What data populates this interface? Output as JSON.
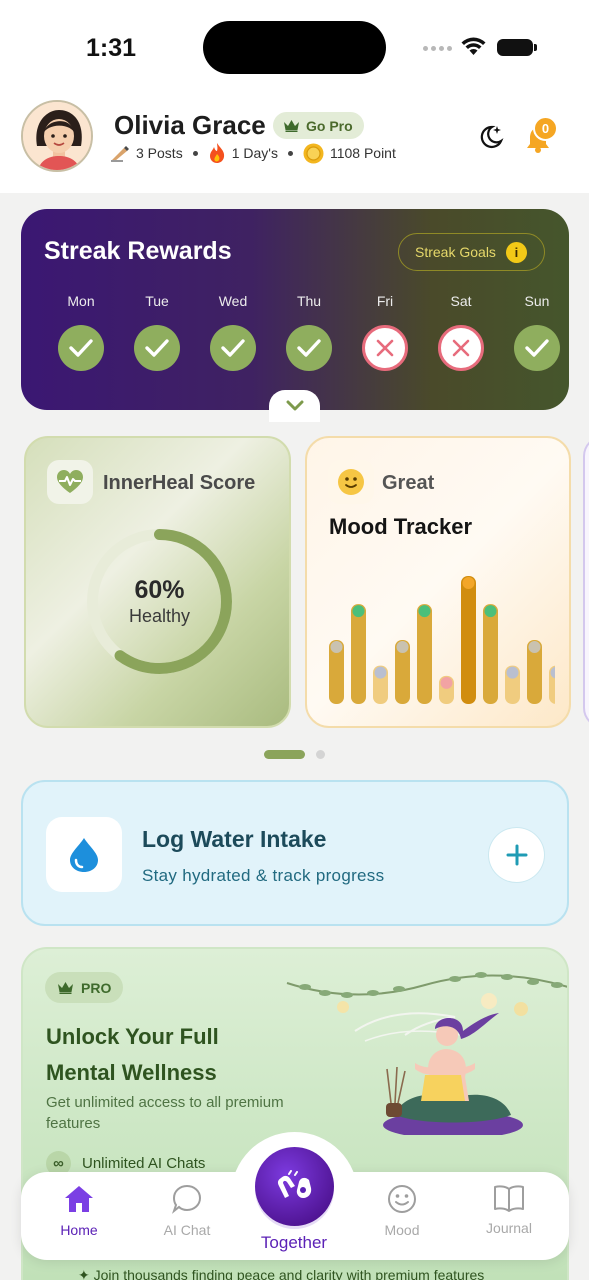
{
  "status_bar": {
    "time": "1:31"
  },
  "profile": {
    "name": "Olivia Grace",
    "go_pro_label": "Go Pro",
    "posts": "3 Posts",
    "streak_days": "1 Day's",
    "points": "1108 Point",
    "notification_count": "0"
  },
  "streak": {
    "title": "Streak Rewards",
    "goals_label": "Streak Goals",
    "info_glyph": "i",
    "days": [
      {
        "label": "Mon",
        "status": "done"
      },
      {
        "label": "Tue",
        "status": "done"
      },
      {
        "label": "Wed",
        "status": "done"
      },
      {
        "label": "Thu",
        "status": "done"
      },
      {
        "label": "Fri",
        "status": "missed"
      },
      {
        "label": "Sat",
        "status": "missed"
      },
      {
        "label": "Sun",
        "status": "done"
      }
    ]
  },
  "innerheal": {
    "title": "InnerHeal Score",
    "percent_text": "60%",
    "status": "Healthy",
    "progress": 0.6
  },
  "mood": {
    "current_mood": "Great",
    "title": "Mood Tracker",
    "bar_levels": [
      0.5,
      0.78,
      0.3,
      0.5,
      0.78,
      0.22,
      1.0,
      0.78,
      0.3,
      0.5,
      0.3
    ],
    "colors": {
      "bar": "#d9a93a",
      "bar_light": "#f0cc7f",
      "peak": "#d18d0f"
    }
  },
  "carousel": {
    "active_index": 0,
    "count": 2
  },
  "water": {
    "title": "Log Water Intake",
    "subtitle": "Stay hydrated & track progress",
    "add_glyph": "+"
  },
  "pro": {
    "badge": "PRO",
    "title": "Unlock Your Full Mental Wellness",
    "subtitle": "Get unlimited access to all premium features",
    "feature": "Unlimited AI Chats",
    "footer": "Join thousands finding peace and clarity with premium features"
  },
  "nav": {
    "home": "Home",
    "ai_chat": "AI Chat",
    "together": "Together",
    "mood": "Mood",
    "journal": "Journal"
  },
  "colors": {
    "accent_purple": "#5b21b6",
    "streak_green": "#8fae5e",
    "missed_red": "#e76b7c",
    "water_blue": "#1d8fdc"
  }
}
